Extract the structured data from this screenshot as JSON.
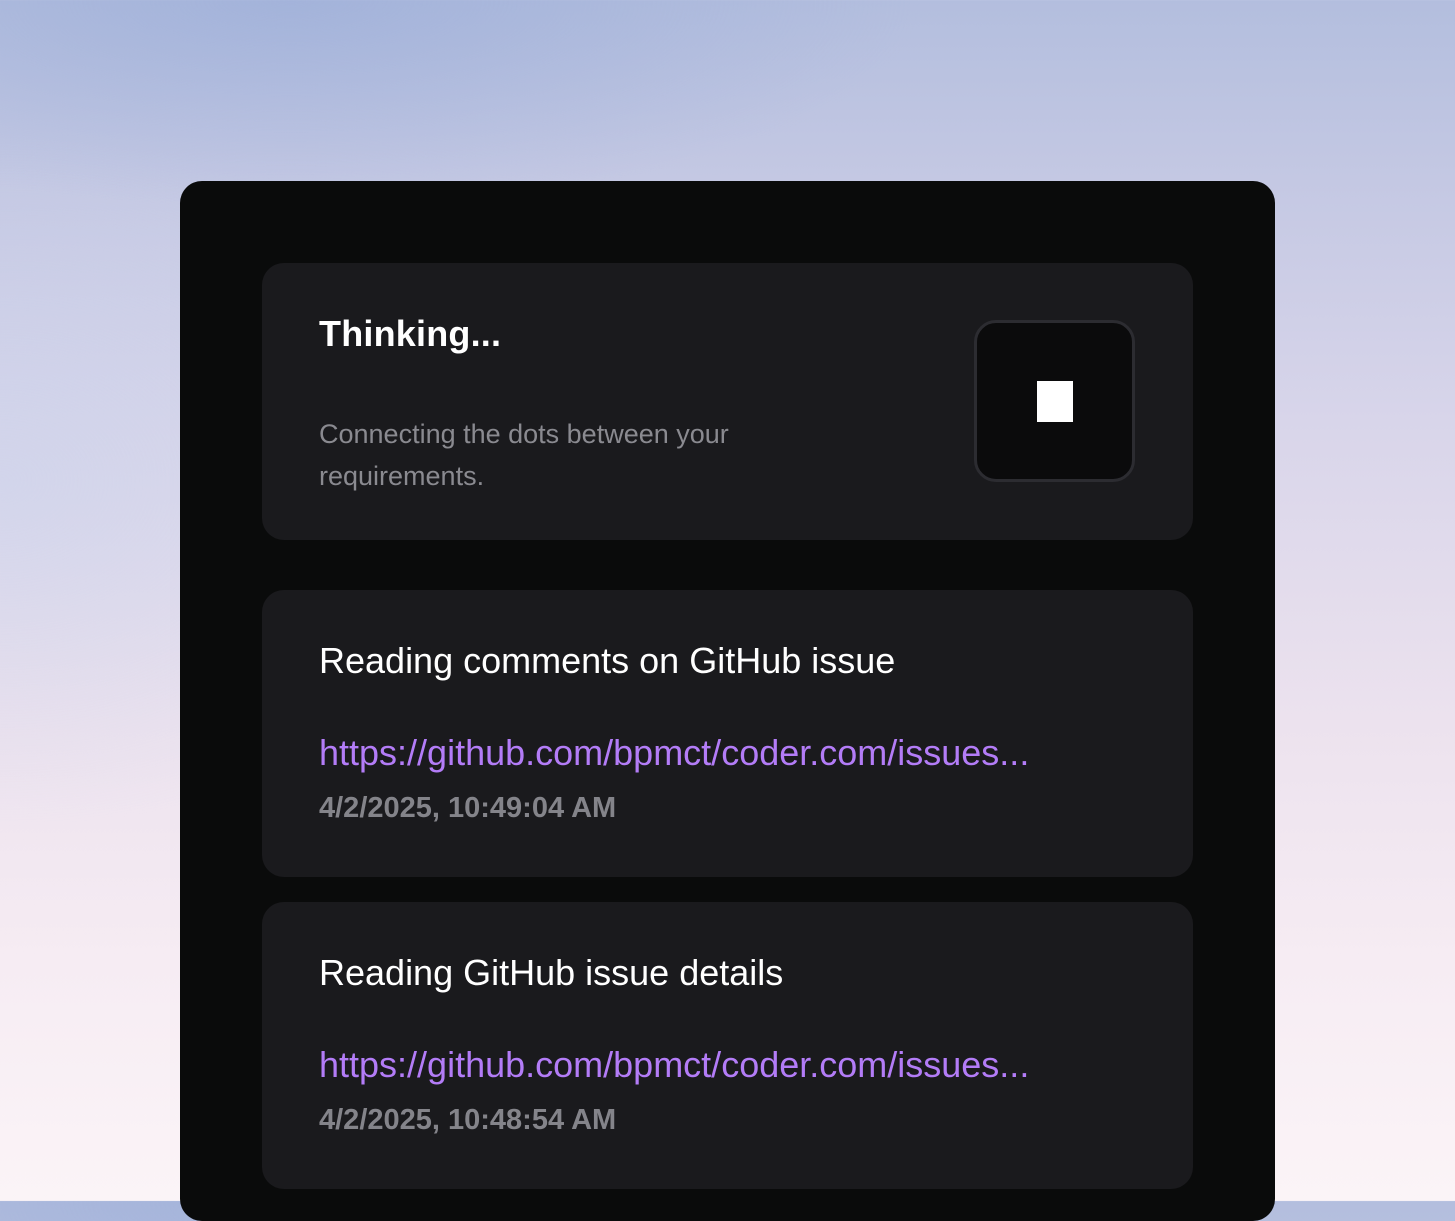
{
  "status": {
    "title": "Thinking...",
    "description": "Connecting the dots between your requirements.",
    "stop_icon": "stop-square-icon"
  },
  "activities": [
    {
      "title": "Reading comments on GitHub issue",
      "link": "https://github.com/bpmct/coder.com/issues...",
      "timestamp": "4/2/2025, 10:49:04 AM"
    },
    {
      "title": "Reading GitHub issue details",
      "link": "https://github.com/bpmct/coder.com/issues...",
      "timestamp": "4/2/2025, 10:48:54 AM"
    }
  ],
  "colors": {
    "panel_background": "#0a0b0b",
    "card_background": "#1a1a1d",
    "link": "#b37cf7",
    "muted_text": "#84848a"
  }
}
